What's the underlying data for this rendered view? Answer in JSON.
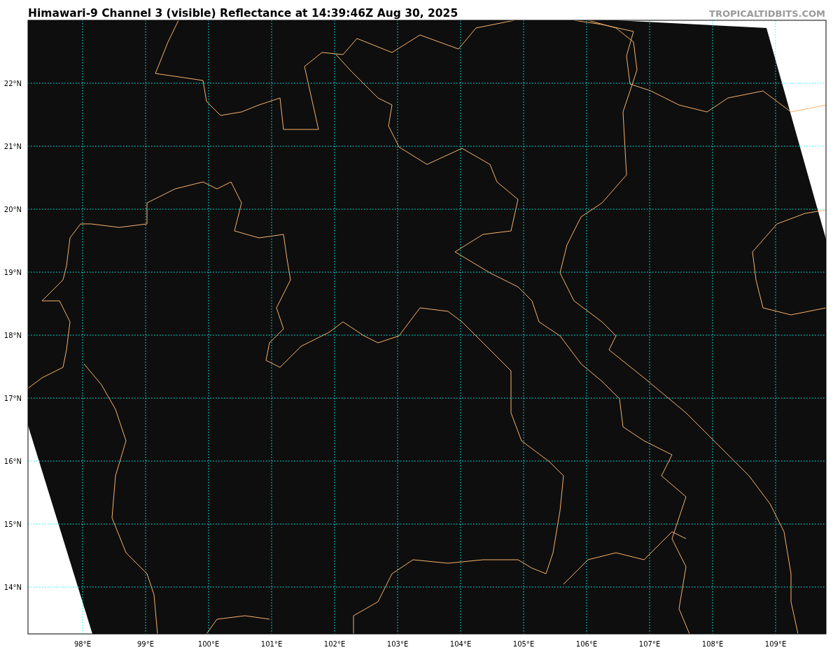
{
  "title": "Himawari-9 Channel 3 (visible) Reflectance at 14:39:46Z Aug 30, 2025",
  "site_label": "TROPICALTIDBITS.COM",
  "map": {
    "lat_labels": [
      "22°N",
      "21°N",
      "20°N",
      "19°N",
      "18°N",
      "17°N",
      "16°N",
      "15°N",
      "14°N"
    ],
    "lon_labels": [
      "98°E",
      "99°E",
      "100°E",
      "101°E",
      "102°E",
      "103°E",
      "104°E",
      "105°E",
      "106°E",
      "107°E",
      "108°E",
      "109°E"
    ]
  }
}
